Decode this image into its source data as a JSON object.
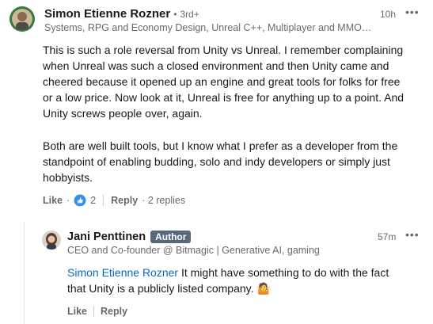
{
  "comment": {
    "author": "Simon Etienne Rozner",
    "degree_sep": "•",
    "degree": "3rd+",
    "headline": "Systems, RPG and Economy Design, Unreal C++, Multiplayer and MMO…",
    "time": "10h",
    "more_icon": "•••",
    "paragraph1_lines": [
      "This is such a role reversal from Unity vs Unreal. I remember complaining",
      "when Unreal was such a closed environment and then Unity came and",
      "cheered because it opened up an engine and great tools for folks for free",
      "or a low price. Now look at it, Unreal is free for anything up to a point. And",
      "Unity screws people over, again."
    ],
    "paragraph2_lines": [
      "Both are well built tools, but I know what I prefer as a developer from the",
      "standpoint of enabling budding, solo and indy developers or simply just",
      "hobbyists."
    ],
    "like_label": "Like",
    "dot": "·",
    "reaction_count": "2",
    "reply_label": "Reply",
    "replies_count": "· 2 replies"
  },
  "reply": {
    "author": "Jani Penttinen",
    "badge": "Author",
    "headline": "CEO and Co-founder @ Bitmagic | Generative AI, gaming",
    "time": "57m",
    "more_icon": "•••",
    "mention": "Simon Etienne Rozner",
    "text_line1_rest": " It might have something to do with the fact",
    "text_line2": "that Unity is a publicly listed company. 🤷",
    "like_label": "Like",
    "reply_label": "Reply"
  },
  "colors": {
    "accent_blue": "#0a66c2",
    "badge_gray": "#56687a",
    "like_icon_blue": "#378fe9"
  }
}
